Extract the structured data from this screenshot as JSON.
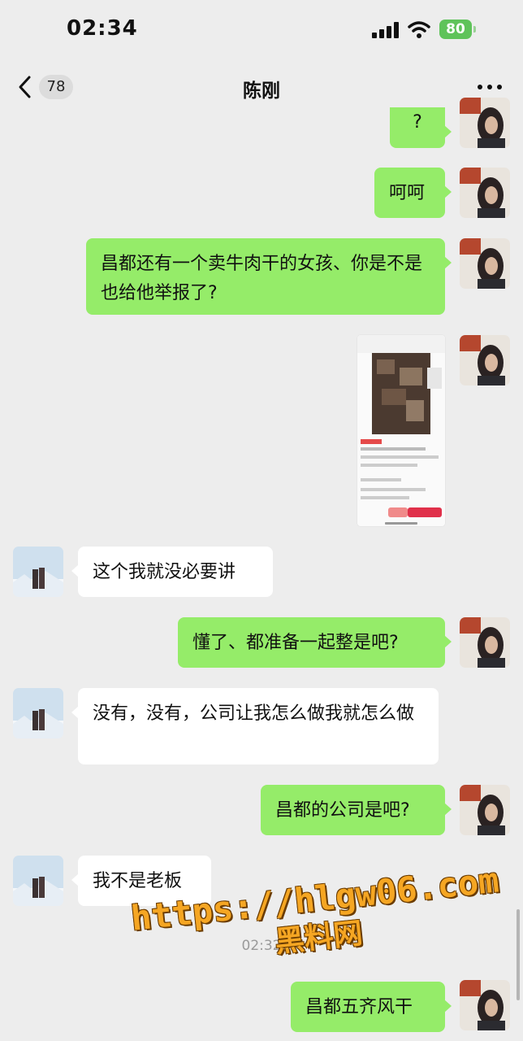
{
  "status_bar": {
    "time": "02:34",
    "battery": "80"
  },
  "nav": {
    "unread_count": "78",
    "title": "陈刚"
  },
  "messages": [
    {
      "from": "me",
      "text": "?"
    },
    {
      "from": "me",
      "text": "呵呵"
    },
    {
      "from": "me",
      "text": "昌都还有一个卖牛肉干的女孩、你是不是也给他举报了?"
    },
    {
      "from": "me",
      "type": "image"
    },
    {
      "from": "other",
      "text": "这个我就没必要讲"
    },
    {
      "from": "me",
      "text": "懂了、都准备一起整是吧?"
    },
    {
      "from": "other",
      "text": "没有，没有，公司让我怎么做我就怎么做"
    },
    {
      "from": "me",
      "text": "昌都的公司是吧?"
    },
    {
      "from": "other",
      "text": "我不是老板"
    },
    {
      "from": "me",
      "text": "昌都五齐风干"
    }
  ],
  "timestamp": "02:32",
  "watermark": {
    "url": "https://hlgw06.com",
    "name": "黑料网"
  },
  "colors": {
    "my_bubble": "#95ec69",
    "other_bubble": "#ffffff",
    "background": "#ededed"
  }
}
